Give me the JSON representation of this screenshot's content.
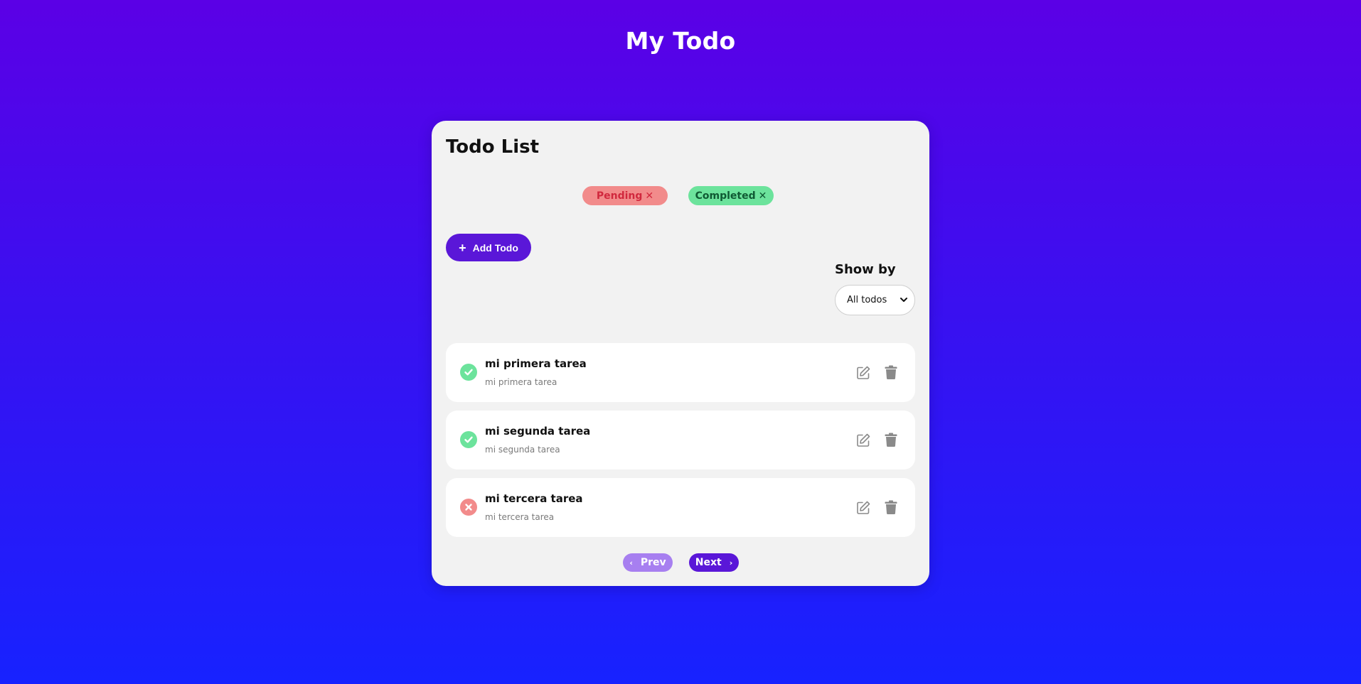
{
  "header": {
    "title": "My Todo"
  },
  "card": {
    "title": "Todo List",
    "tags": {
      "pending": "Pending",
      "completed": "Completed",
      "remove_glyph": "✕"
    },
    "add_button": {
      "icon": "plus-icon",
      "label": "Add Todo",
      "glyph": "+"
    },
    "filter": {
      "label": "Show by",
      "selected": "All todos"
    },
    "todos": [
      {
        "title": "mi primera tarea",
        "description": "mi primera tarea",
        "status": "completed"
      },
      {
        "title": "mi segunda tarea",
        "description": "mi segunda tarea",
        "status": "completed"
      },
      {
        "title": "mi tercera tarea",
        "description": "mi tercera tarea",
        "status": "pending"
      }
    ],
    "pagination": {
      "prev": "Prev",
      "next": "Next",
      "prev_glyph": "‹",
      "next_glyph": "›"
    }
  },
  "colors": {
    "accent": "#5a17d8",
    "pending": "#f28b8b",
    "completed": "#6ce39c",
    "background_top": "#5b00e6",
    "background_bottom": "#1722ff"
  }
}
